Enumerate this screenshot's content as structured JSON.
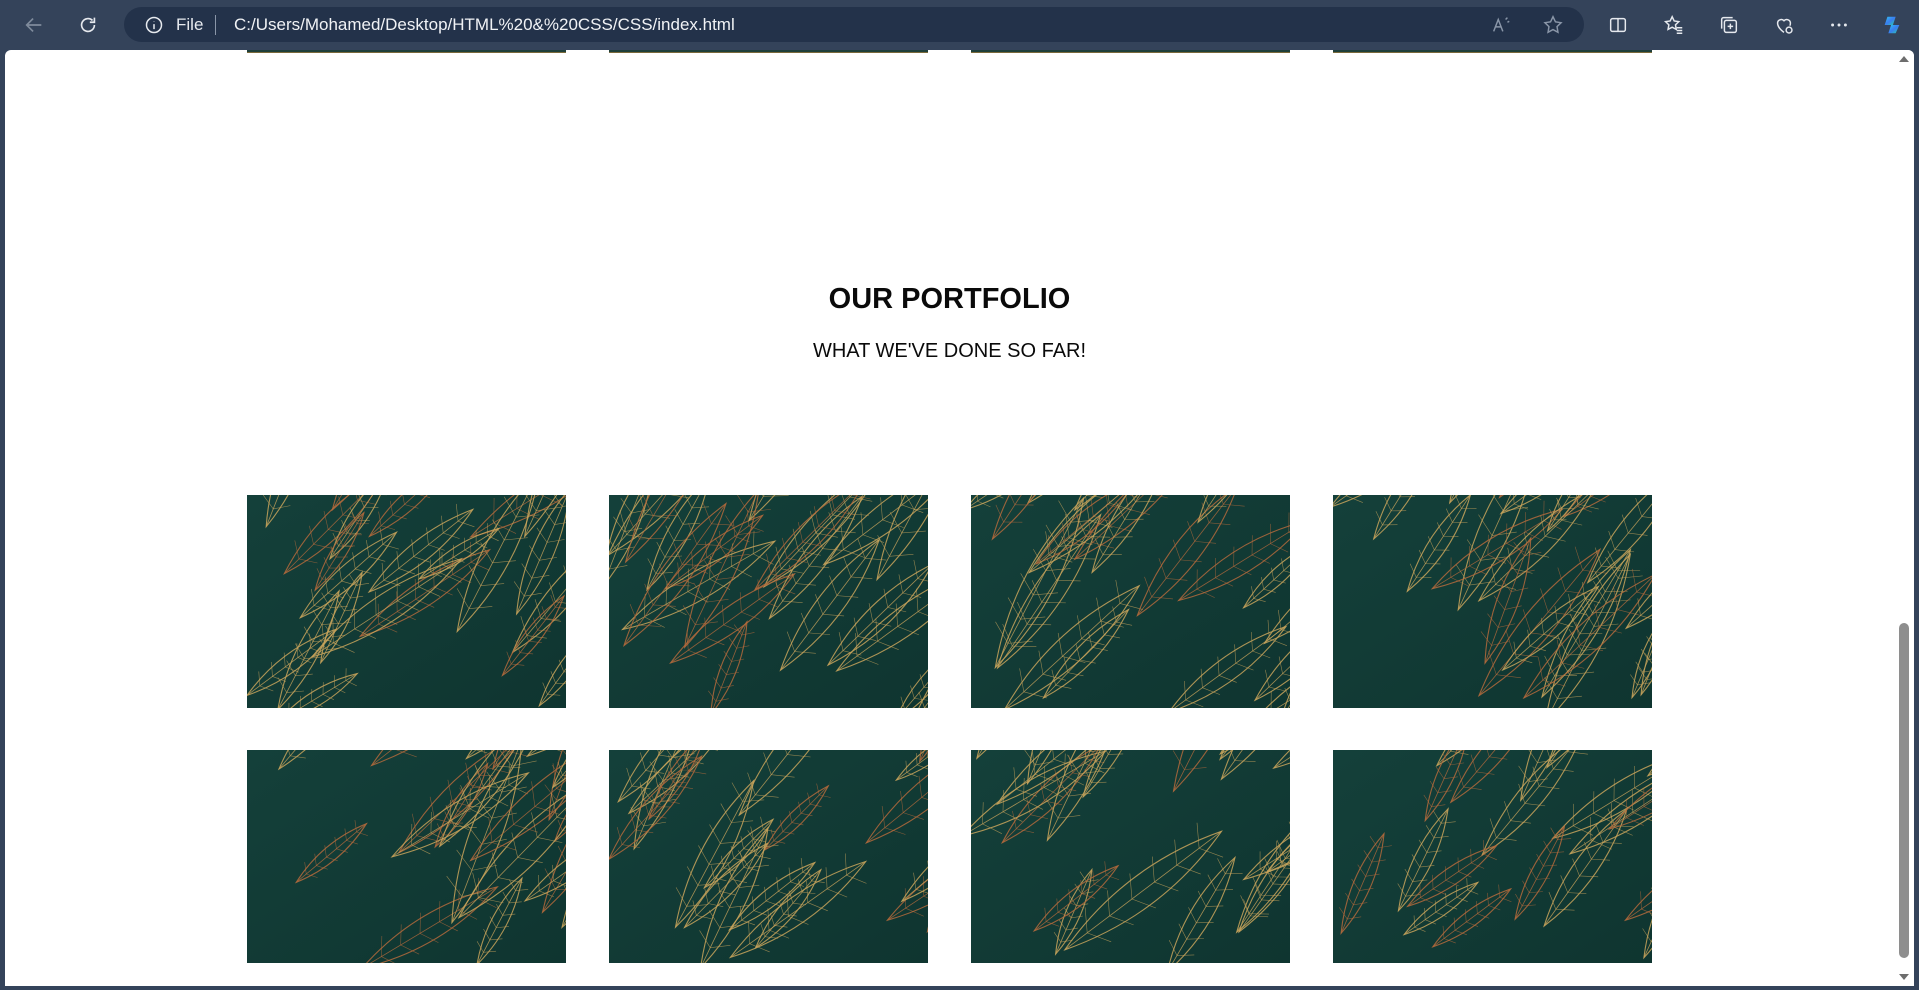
{
  "browser": {
    "address_bar": {
      "scheme_label": "File",
      "url": "C:/Users/Mohamed/Desktop/HTML%20&%20CSS/CSS/index.html"
    },
    "icons": [
      "back-icon",
      "refresh-icon",
      "info-icon",
      "read-aloud-icon",
      "favorite-star-icon",
      "split-screen-icon",
      "favorites-icon",
      "collections-icon",
      "browser-essentials-icon",
      "more-icon",
      "copilot-icon"
    ]
  },
  "page": {
    "portfolio": {
      "title": "OUR PORTFOLIO",
      "subtitle": "WHAT WE'VE DONE SO FAR!",
      "images": [
        {
          "row": 1,
          "col": 1
        },
        {
          "row": 1,
          "col": 2
        },
        {
          "row": 1,
          "col": 3
        },
        {
          "row": 1,
          "col": 4
        },
        {
          "row": 2,
          "col": 1
        },
        {
          "row": 2,
          "col": 2
        },
        {
          "row": 2,
          "col": 3
        },
        {
          "row": 2,
          "col": 4
        }
      ]
    }
  },
  "colors": {
    "toolbar_bg": "#34435a",
    "image_bg": "#14403a",
    "leaf_gold": "#c9a45c",
    "leaf_copper": "#b46a3c"
  }
}
